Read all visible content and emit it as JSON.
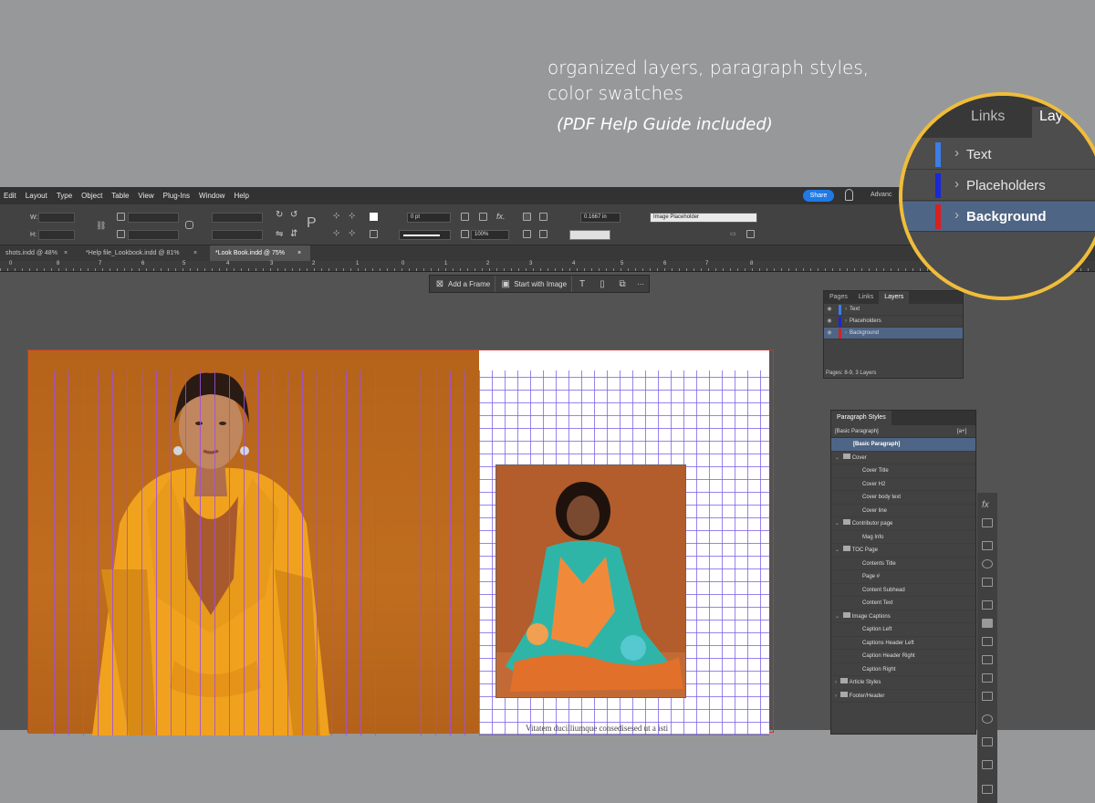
{
  "promo": {
    "headline_line1": "organized layers, paragraph styles,",
    "headline_line2": "color swatches",
    "subline": "(PDF Help Guide included)"
  },
  "menubar": {
    "items": [
      "Edit",
      "Layout",
      "Type",
      "Object",
      "Table",
      "View",
      "Plug-Ins",
      "Window",
      "Help"
    ],
    "share": "Share",
    "workspace": "Advanc"
  },
  "control_bar": {
    "w_label": "W:",
    "h_label": "H:",
    "stroke_weight": "0 pt",
    "zoom_pct": "100%",
    "offset": "0.1667 in",
    "object_style": "Image Placeholder"
  },
  "document_tabs": [
    {
      "label": "shots.indd @ 48%",
      "close": "×",
      "active": false
    },
    {
      "label": "*Help file_Lookbook.indd @ 81%",
      "close": "×",
      "active": false
    },
    {
      "label": "*Look Book.indd @ 75%",
      "close": "×",
      "active": true
    }
  ],
  "ruler_numbers": [
    "0",
    "8",
    "7",
    "6",
    "5",
    "4",
    "3",
    "2",
    "1",
    "0",
    "1",
    "2",
    "3",
    "4",
    "5",
    "6",
    "7",
    "8"
  ],
  "context_bar": {
    "add_frame": "Add a Frame",
    "start_image": "Start with Image",
    "more": "···"
  },
  "page_text": {
    "body_snippet": "Vitatem ducilliumque consedisesed ut a isti"
  },
  "layers_panel": {
    "tabs": [
      "Pages",
      "Links",
      "Layers"
    ],
    "active_tab": "Layers",
    "layers": [
      {
        "name": "Text",
        "color": "#3d7de8",
        "selected": false
      },
      {
        "name": "Placeholders",
        "color": "#1a28d8",
        "selected": false
      },
      {
        "name": "Background",
        "color": "#d82020",
        "selected": true
      }
    ],
    "footer": "Pages: 8-9, 3 Layers"
  },
  "paragraph_panel": {
    "title": "Paragraph Styles",
    "current": "[Basic Paragraph]",
    "new_style_hint": "[a+]",
    "rows": [
      {
        "label": "[Basic Paragraph]",
        "kind": "style",
        "selected": true
      },
      {
        "label": "Cover",
        "kind": "group",
        "open": true
      },
      {
        "label": "Cover Title",
        "kind": "style"
      },
      {
        "label": "Cover H2",
        "kind": "style"
      },
      {
        "label": "Cover body text",
        "kind": "style"
      },
      {
        "label": "Cover line",
        "kind": "style"
      },
      {
        "label": "Contributor page",
        "kind": "group",
        "open": true
      },
      {
        "label": "Mag Info",
        "kind": "style"
      },
      {
        "label": "TOC Page",
        "kind": "group",
        "open": true
      },
      {
        "label": "Contents Title",
        "kind": "style"
      },
      {
        "label": "Page #",
        "kind": "style"
      },
      {
        "label": "Content Subhead",
        "kind": "style"
      },
      {
        "label": "Content Text",
        "kind": "style"
      },
      {
        "label": "Image Captions",
        "kind": "group",
        "open": true
      },
      {
        "label": "Caption Left",
        "kind": "style"
      },
      {
        "label": "Captions Header Left",
        "kind": "style"
      },
      {
        "label": "Caption Header Right",
        "kind": "style"
      },
      {
        "label": "Caption Right",
        "kind": "style"
      },
      {
        "label": "Article Styles",
        "kind": "group",
        "open": false
      },
      {
        "label": "Footer/Header",
        "kind": "group",
        "open": false
      }
    ]
  },
  "magnifier": {
    "tabs": [
      "Links",
      "Lay"
    ],
    "rows": [
      {
        "name": "Text",
        "color": "#3d7de8",
        "selected": false
      },
      {
        "name": "Placeholders",
        "color": "#1a28d8",
        "selected": false
      },
      {
        "name": "Background",
        "color": "#d82020",
        "selected": true
      }
    ]
  }
}
